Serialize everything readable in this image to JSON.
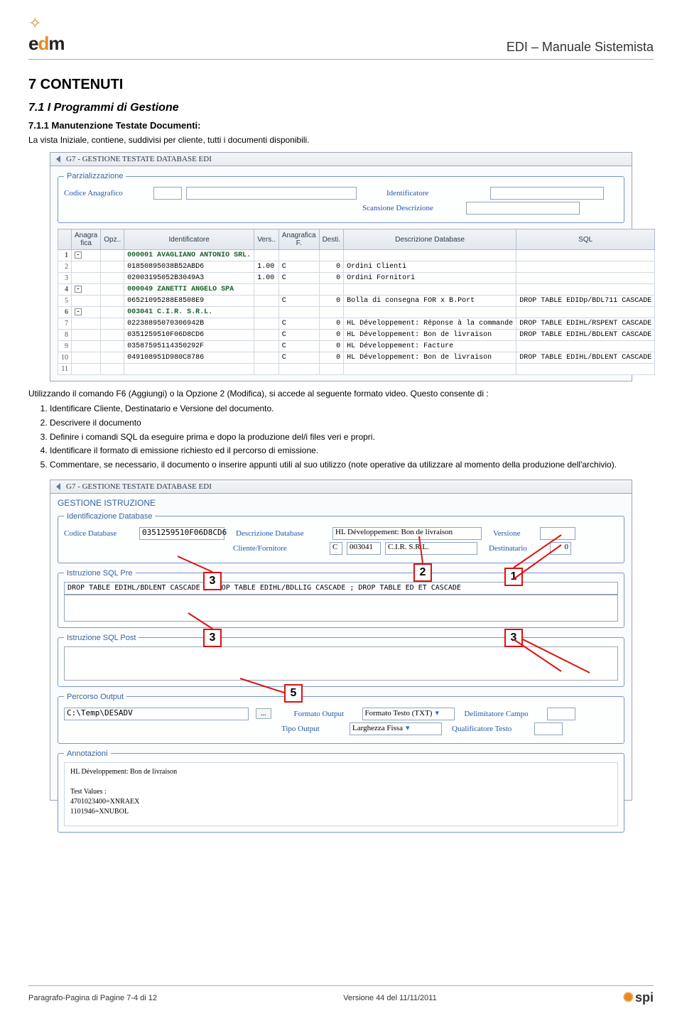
{
  "header": {
    "doc_title": "EDI – Manuale Sistemista"
  },
  "headings": {
    "h1": "7  CONTENUTI",
    "h2": "7.1  I Programmi di Gestione",
    "h3": "7.1.1  Manutenzione Testate Documenti:"
  },
  "paragraphs": {
    "intro": "La vista Iniziale, contiene, suddivisi per cliente, tutti i documenti disponibili.",
    "after_shot1": "Utilizzando il comando F6 (Aggiungi) o la Opzione 2 (Modifica), si accede al seguente formato video. Questo consente di :"
  },
  "list": [
    "Identificare Cliente, Destinatario e Versione del documento.",
    "Descrivere il documento",
    "Definire i comandi SQL da eseguire prima e dopo la produzione del/i files veri e propri.",
    "Identificare il formato di emissione richiesto ed il percorso di emissione.",
    "Commentare, se necessario, il documento o inserire appunti utili al suo utilizzo (note operative da utilizzare al momento della produzione dell'archivio)."
  ],
  "shot1": {
    "window_title": "G7 - GESTIONE TESTATE DATABASE EDI",
    "parz_legend": "Parzializzazione",
    "labels": {
      "codice_anagrafico": "Codice Anagrafico",
      "identificatore": "Identificatore",
      "scansione": "Scansione Descrizione"
    },
    "columns": [
      "",
      "Anagra fica",
      "Opz..",
      "Identificatore",
      "Vers..",
      "Anagrafica F.",
      "Desti.",
      "Descrizione Database",
      "SQL"
    ],
    "rows": [
      {
        "n": "1",
        "bold": true,
        "tree": "-",
        "fica": "",
        "opz": "",
        "id": "000001 AVAGLIANO ANTONIO SRL.",
        "vers": "",
        "af": "",
        "desti": "",
        "desc": "",
        "sql": ""
      },
      {
        "n": "2",
        "bold": false,
        "tree": "",
        "fica": "",
        "opz": "",
        "id": "01850895038B52ABD6",
        "vers": "1.00",
        "af": "C",
        "desti": "0",
        "desc": "Ordini Clienti",
        "sql": ""
      },
      {
        "n": "3",
        "bold": false,
        "tree": "",
        "fica": "",
        "opz": "",
        "id": "02003195052B3049A3",
        "vers": "1.00",
        "af": "C",
        "desti": "0",
        "desc": "Ordini Fornitori",
        "sql": ""
      },
      {
        "n": "4",
        "bold": true,
        "tree": "-",
        "fica": "",
        "opz": "",
        "id": "000049 ZANETTI ANGELO SPA",
        "vers": "",
        "af": "",
        "desti": "",
        "desc": "",
        "sql": ""
      },
      {
        "n": "5",
        "bold": false,
        "tree": "",
        "fica": "",
        "opz": "",
        "id": "06521095288E8508E9",
        "vers": "",
        "af": "C",
        "desti": "0",
        "desc": "Bolla di consegna FOR x B.Port",
        "sql": "DROP TABLE EDIDp/BDL711 CASCADE"
      },
      {
        "n": "6",
        "bold": true,
        "tree": "-",
        "fica": "",
        "opz": "",
        "id": "003041 C.I.R. S.R.L.",
        "vers": "",
        "af": "",
        "desti": "",
        "desc": "",
        "sql": ""
      },
      {
        "n": "7",
        "bold": false,
        "tree": "",
        "fica": "",
        "opz": "",
        "id": "02238895070306942B",
        "vers": "",
        "af": "C",
        "desti": "0",
        "desc": "HL Développement: Réponse à la commande",
        "sql": "DROP TABLE EDIHL/RSPENT CASCADE"
      },
      {
        "n": "8",
        "bold": false,
        "tree": "",
        "fica": "",
        "opz": "",
        "id": "0351259510F06D8CD6",
        "vers": "",
        "af": "C",
        "desti": "0",
        "desc": "HL Développement: Bon de livraison",
        "sql": "DROP TABLE EDIHL/BDLENT CASCADE"
      },
      {
        "n": "9",
        "bold": false,
        "tree": "",
        "fica": "",
        "opz": "",
        "id": "03587595114350292F",
        "vers": "",
        "af": "C",
        "desti": "0",
        "desc": "HL Développement: Facture",
        "sql": ""
      },
      {
        "n": "10",
        "bold": false,
        "tree": "",
        "fica": "",
        "opz": "",
        "id": "049108951D980C8786",
        "vers": "",
        "af": "C",
        "desti": "0",
        "desc": "HL Développement: Bon de livraison",
        "sql": "DROP TABLE EDIHL/BDLENT CASCADE"
      },
      {
        "n": "11",
        "bold": false,
        "tree": "",
        "fica": "",
        "opz": "",
        "id": "",
        "vers": "",
        "af": "",
        "desti": "",
        "desc": "",
        "sql": ""
      }
    ]
  },
  "shot2": {
    "window_title": "G7 - GESTIONE TESTATE DATABASE EDI",
    "tab": "GESTIONE ISTRUZIONE",
    "legends": {
      "ident": "Identificazione Database",
      "sqlpre": "Istruzione SQL Pre",
      "sqlpost": "Istruzione SQL Post",
      "outpath": "Percorso Output",
      "annot": "Annotazioni"
    },
    "labels": {
      "codice_db": "Codice Database",
      "desc_db": "Descrizione Database",
      "versione": "Versione",
      "cliente_forn": "Cliente/Fornitore",
      "destinatario": "Destinatario",
      "formato_output": "Formato Output",
      "tipo_output": "Tipo Output",
      "delim_campo": "Delimitatore Campo",
      "qualif_testo": "Qualificatore Testo"
    },
    "values": {
      "codice_db": "0351259510F06D8CD6",
      "desc_db": "HL Développement: Bon de livraison",
      "cliente_forn_code": "C",
      "cliente_forn_num": "003041",
      "cliente_forn_name": "C.I.R. S.R.L.",
      "destinatario": "0",
      "sql_pre": "DROP TABLE EDIHL/BDLENT CASCADE ; DROP TABLE EDIHL/BDLLIG CASCADE ; DROP TABLE ED          ET CASCADE",
      "outpath": "C:\\Temp\\DESADV",
      "formato_output": "Formato Testo (TXT)",
      "tipo_output": "Larghezza Fissa",
      "annot1": "HL Développement: Bon de livraison",
      "annot2": "Test Values :",
      "annot3": "4701023400=XNRAEX",
      "annot4": "1101946=XNUBOL"
    },
    "callouts": [
      "2",
      "3",
      "1",
      "3",
      "3",
      "5"
    ]
  },
  "footer": {
    "left": "Paragrafo-Pagina di Pagine 7-4 di 12",
    "center": "Versione 44 del 11/11/2011",
    "spi": "spi"
  }
}
